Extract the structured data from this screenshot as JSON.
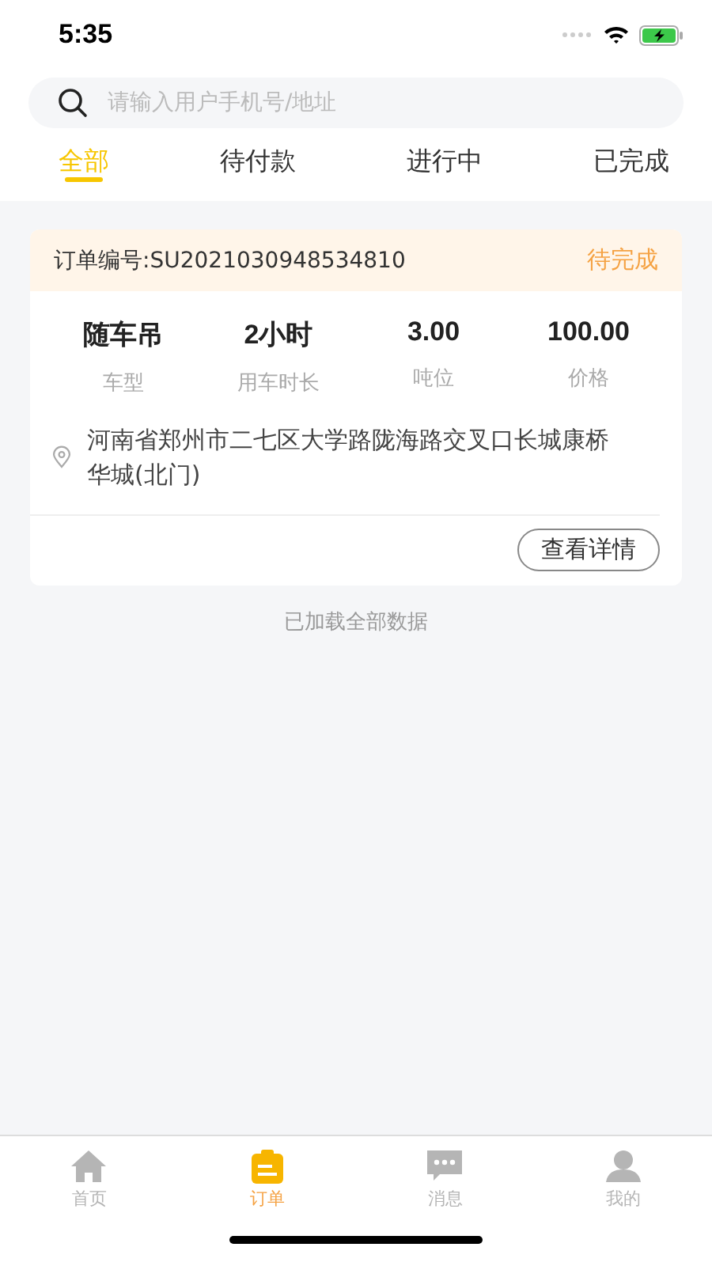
{
  "status_bar": {
    "time": "5:35"
  },
  "search": {
    "placeholder": "请输入用户手机号/地址"
  },
  "tabs": [
    {
      "label": "全部",
      "selected": true
    },
    {
      "label": "待付款",
      "selected": false
    },
    {
      "label": "进行中",
      "selected": false
    },
    {
      "label": "已完成",
      "selected": false
    }
  ],
  "orders": [
    {
      "number": "订单编号:SU2021030948534810",
      "status": "待完成",
      "fields": [
        {
          "value": "随车吊",
          "label": "车型"
        },
        {
          "value": "2小时",
          "label": "用车时长"
        },
        {
          "value": "3.00",
          "label": "吨位"
        },
        {
          "value": "100.00",
          "label": "价格"
        }
      ],
      "address": "河南省郑州市二七区大学路陇海路交叉口长城康桥华城(北门)",
      "button": "查看详情"
    }
  ],
  "list_footer": "已加载全部数据",
  "bottom_nav": [
    {
      "kind": "home",
      "label": "首页",
      "selected": false
    },
    {
      "kind": "orders",
      "label": "订单",
      "selected": true
    },
    {
      "kind": "messages",
      "label": "消息",
      "selected": false
    },
    {
      "kind": "profile",
      "label": "我的",
      "selected": false
    }
  ]
}
